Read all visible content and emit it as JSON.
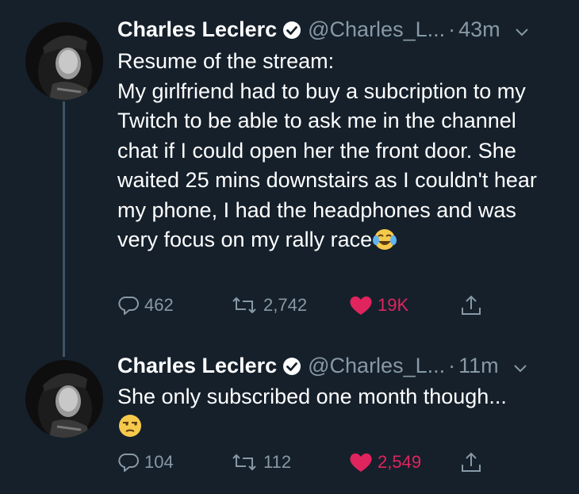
{
  "tweets": [
    {
      "name": "Charles Leclerc",
      "handle": "@Charles_L...",
      "separator": "·",
      "time": "43m",
      "text": "Resume of the stream:\nMy girlfriend had to buy a subcription to my Twitch to be able to ask me in the channel chat if I could open her the front door. She waited 25 mins downstairs as I couldn't hear my phone, I had the headphones and was very focus on my rally race",
      "replies": "462",
      "retweets": "2,742",
      "likes": "19K"
    },
    {
      "name": "Charles Leclerc",
      "handle": "@Charles_L...",
      "separator": "·",
      "time": "11m",
      "text": "She only subscribed one month though...",
      "replies": "104",
      "retweets": "112",
      "likes": "2,549"
    }
  ],
  "icons": {
    "verified": "verified-badge-icon",
    "caret": "chevron-down-icon",
    "reply": "reply-icon",
    "retweet": "retweet-icon",
    "like": "heart-icon",
    "share": "share-icon",
    "emoji_laugh": "tears-of-joy-emoji",
    "emoji_unamused": "unamused-emoji"
  },
  "colors": {
    "background": "#15202b",
    "secondary_text": "#8899a6",
    "like_active": "#e0245e",
    "thread_line": "#3d5466"
  }
}
